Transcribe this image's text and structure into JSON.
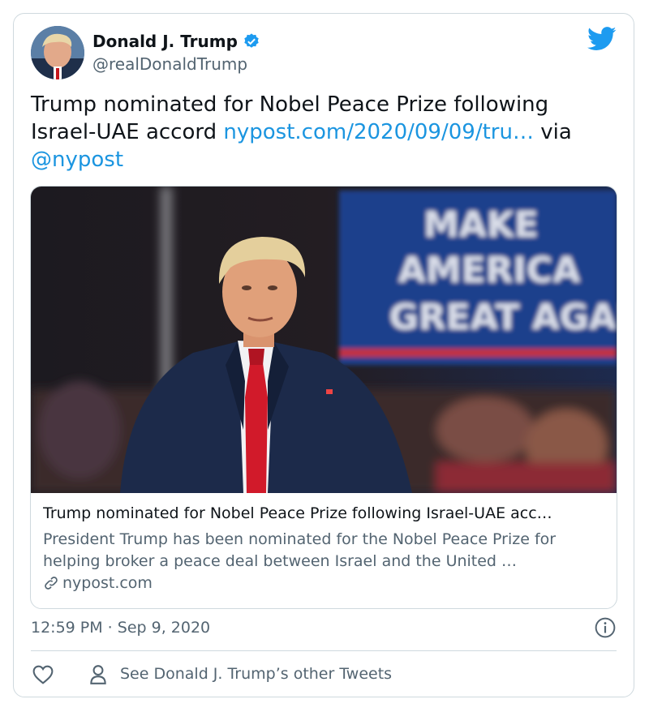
{
  "tweet": {
    "author_name": "Donald J. Trump",
    "author_handle": "@realDonaldTrump",
    "text_main": "Trump nominated for Nobel Peace Prize following Israel-UAE accord ",
    "text_link": "nypost.com/2020/09/09/tru…",
    "text_via": " via ",
    "text_mention": "@nypost",
    "timestamp": "12:59 PM · Sep 9, 2020"
  },
  "card": {
    "title": "Trump nominated for Nobel Peace Prize following Israel-UAE acc…",
    "description": "President Trump has been nominated for the Nobel Peace Prize for helping broker a peace deal between Israel and the United …",
    "domain": "nypost.com",
    "banner_text": [
      "MAKE",
      "AMERICA",
      "GREAT AGAI"
    ]
  },
  "footer": {
    "other_tweets": "See Donald J. Trump’s other Tweets"
  },
  "icons": {
    "verified": "verified-badge-icon",
    "brand": "twitter-bird-icon",
    "info": "info-icon",
    "like": "heart-icon",
    "profile": "user-icon",
    "link": "link-icon"
  },
  "colors": {
    "link": "#1b95e0",
    "secondary_text": "#536471",
    "border": "#cfd9de",
    "brand": "#1d9bf0"
  }
}
